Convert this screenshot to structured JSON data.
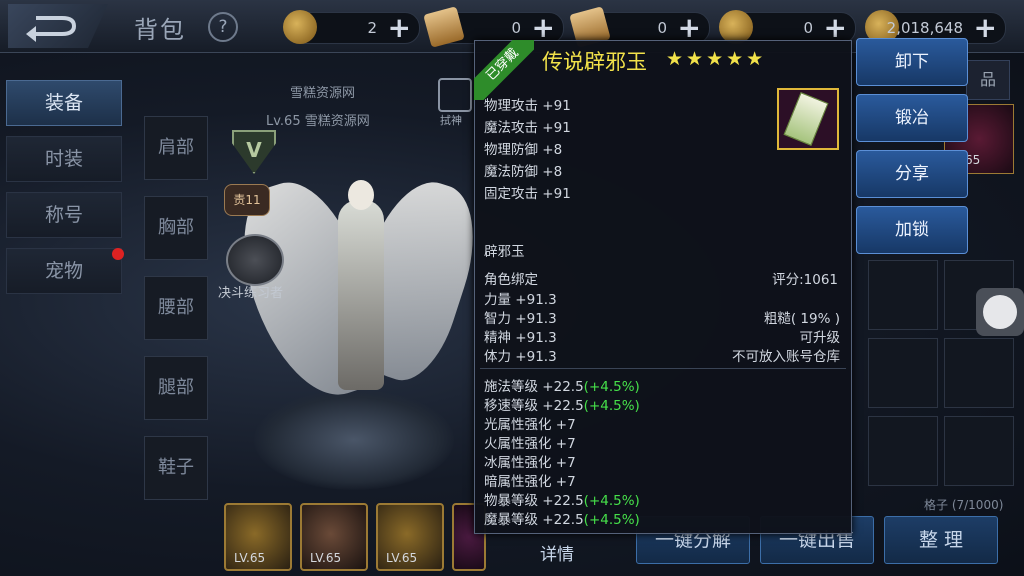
{
  "header": {
    "title": "背包",
    "help_label": "?",
    "currencies": [
      {
        "value": "2",
        "plus": "+"
      },
      {
        "value": "0",
        "plus": "+"
      },
      {
        "value": "0",
        "plus": "+"
      },
      {
        "value": "0",
        "plus": "+"
      },
      {
        "value": "2,018,648",
        "plus": "+"
      }
    ]
  },
  "sidebar": {
    "tabs": [
      {
        "label": "装备"
      },
      {
        "label": "时装"
      },
      {
        "label": "称号"
      },
      {
        "label": "宠物"
      }
    ]
  },
  "equip_slots": [
    {
      "label": "肩部"
    },
    {
      "label": "胸部"
    },
    {
      "label": "腰部"
    },
    {
      "label": "腿部"
    },
    {
      "label": "鞋子"
    }
  ],
  "character": {
    "watermark": "雪糕资源网",
    "level_line": "Lv.65 雪糕资源网",
    "badge_v": "V",
    "badge_rank": "责11",
    "pvp_title": "决斗练习者",
    "edit_label": "拭神"
  },
  "bottom_items": [
    {
      "level": "LV.65"
    },
    {
      "level": "LV.65"
    },
    {
      "level": "LV.65"
    },
    {
      "level": ""
    }
  ],
  "bottom_buttons": {
    "detail": "详情",
    "decompose": "一键分解",
    "sell": "一键出售",
    "sort": "整 理"
  },
  "slots_count": "格子 (7/1000)",
  "tooltip": {
    "equipped_tag": "已穿戴",
    "name": "传说辟邪玉",
    "stars": "★★★★★",
    "base_stats": [
      "物理攻击 +91",
      "魔法攻击 +91",
      "物理防御 +8",
      "魔法防御 +8",
      "固定攻击 +91"
    ],
    "item_type": "辟邪玉",
    "bind": "角色绑定",
    "score": "评分:1061",
    "attrs": [
      {
        "left": "力量 +91.3",
        "right": ""
      },
      {
        "left": "智力 +91.3",
        "right": "粗糙( 19% )"
      },
      {
        "left": "精神 +91.3",
        "right": "可升级"
      },
      {
        "left": "体力 +91.3",
        "right": "不可放入账号仓库"
      }
    ],
    "extra_stats": [
      {
        "text": "施法等级 +22.5",
        "bonus": "(+4.5%)"
      },
      {
        "text": "移速等级 +22.5",
        "bonus": "(+4.5%)"
      },
      {
        "text": "光属性强化 +7",
        "bonus": ""
      },
      {
        "text": "火属性强化 +7",
        "bonus": ""
      },
      {
        "text": "冰属性强化 +7",
        "bonus": ""
      },
      {
        "text": "暗属性强化 +7",
        "bonus": ""
      },
      {
        "text": "物暴等级 +22.5",
        "bonus": "(+4.5%)"
      },
      {
        "text": "魔暴等级 +22.5",
        "bonus": "(+4.5%)"
      }
    ]
  },
  "actions": {
    "unequip": "卸下",
    "forge": "锻冶",
    "share": "分享",
    "lock": "加锁"
  },
  "right_panel": {
    "partial_label": "品",
    "item_level": "65"
  }
}
